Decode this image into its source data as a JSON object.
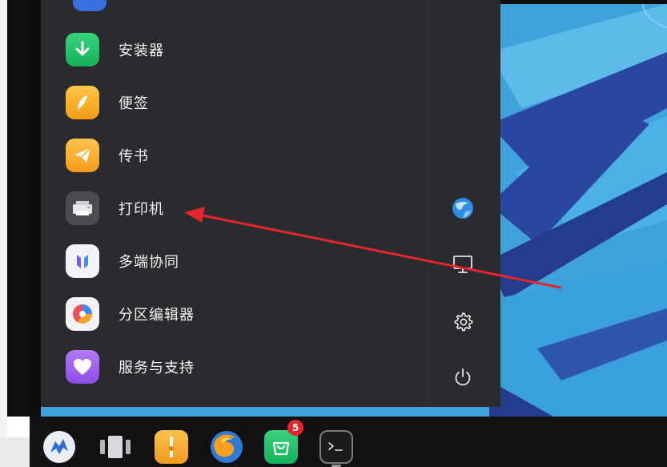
{
  "menu": {
    "items": [
      {
        "label": "安装器",
        "icon": "installer-icon"
      },
      {
        "label": "便签",
        "icon": "notes-icon"
      },
      {
        "label": "传书",
        "icon": "send-file-icon"
      },
      {
        "label": "打印机",
        "icon": "printer-icon"
      },
      {
        "label": "多端协同",
        "icon": "multi-device-icon"
      },
      {
        "label": "分区编辑器",
        "icon": "partition-editor-icon"
      },
      {
        "label": "服务与支持",
        "icon": "service-support-icon"
      }
    ]
  },
  "side_panel": {
    "items": [
      "browser-icon",
      "display-icon",
      "settings-gear-icon",
      "power-icon"
    ]
  },
  "taskbar": {
    "items": [
      "kylin-start-icon",
      "multitask-view-icon",
      "file-manager-icon",
      "firefox-icon",
      "app-store-icon",
      "terminal-icon"
    ],
    "badge_count": "5"
  },
  "colors": {
    "menu_background": "#2a2b2e",
    "taskbar_background": "#121214",
    "wallpaper_blue": "#3fa2dc",
    "wallpaper_navy": "#253b8c",
    "annotation_arrow": "#e3262d",
    "badge_red": "#e5252a"
  }
}
